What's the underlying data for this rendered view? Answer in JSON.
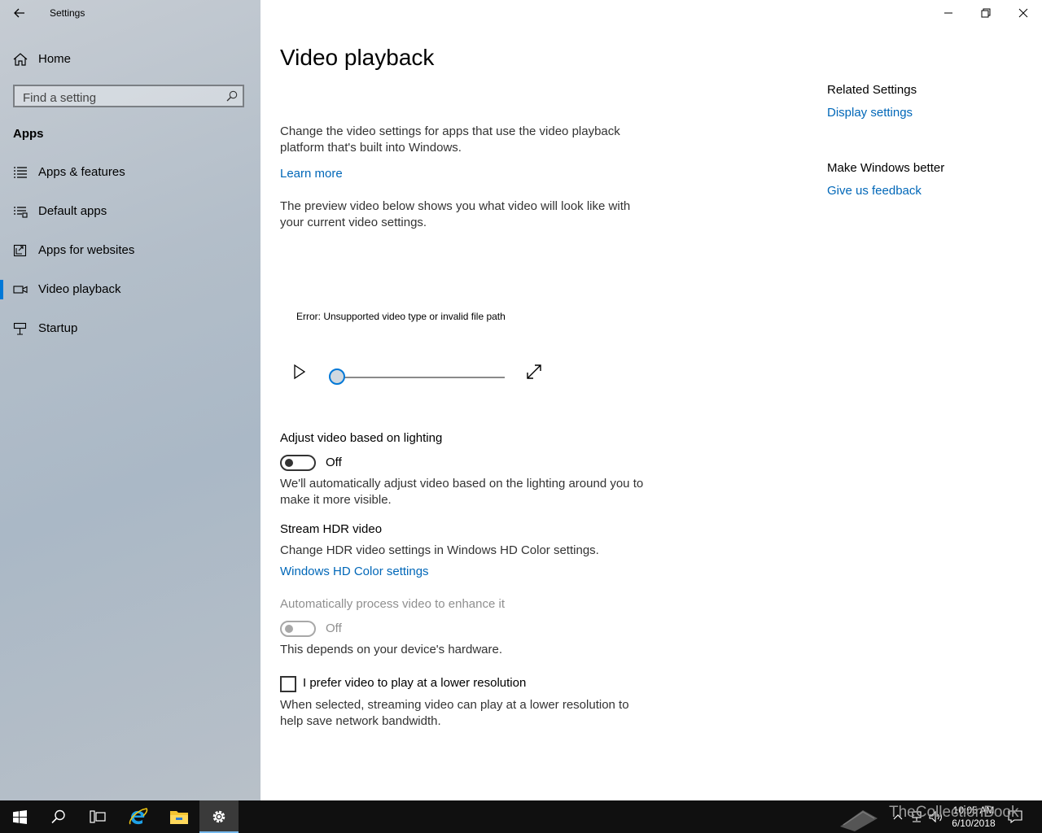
{
  "window": {
    "title": "Settings",
    "controls": [
      "minimize",
      "restore",
      "close"
    ]
  },
  "sidebar": {
    "home_label": "Home",
    "search_placeholder": "Find a setting",
    "section_title": "Apps",
    "items": [
      {
        "label": "Apps & features",
        "icon": "list-icon"
      },
      {
        "label": "Default apps",
        "icon": "default-apps-icon"
      },
      {
        "label": "Apps for websites",
        "icon": "apps-for-websites-icon"
      },
      {
        "label": "Video playback",
        "icon": "video-camera-icon",
        "selected": true
      },
      {
        "label": "Startup",
        "icon": "startup-icon"
      }
    ]
  },
  "main": {
    "title": "Video playback",
    "intro": "Change the video settings for apps that use the video playback platform that's built into Windows.",
    "learn_more": "Learn more",
    "preview_desc": "The preview video below shows you what video will look like with your current video settings.",
    "error_text": "Error: Unsupported video type or invalid file path",
    "player": {
      "progress": 0
    },
    "lighting": {
      "heading": "Adjust video based on lighting",
      "state": "Off",
      "desc": "We'll automatically adjust video based on the lighting around you to make it more visible."
    },
    "hdr": {
      "heading": "Stream HDR video",
      "desc": "Change HDR video settings in Windows HD Color settings.",
      "link": "Windows HD Color settings"
    },
    "enhance": {
      "heading": "Automatically process video to enhance it",
      "state": "Off",
      "desc": "This depends on your device's hardware."
    },
    "lower_res": {
      "label": "I prefer video to play at a lower resolution",
      "checked": false,
      "desc": "When selected, streaming video can play at a lower resolution to help save network bandwidth."
    }
  },
  "related": {
    "heading": "Related Settings",
    "display_link": "Display settings",
    "feedback_heading": "Make Windows better",
    "feedback_link": "Give us feedback"
  },
  "taskbar": {
    "time": "10:05 AM",
    "date": "6/10/2018",
    "watermark": "TheCollectionBook"
  },
  "colors": {
    "accent": "#0078d7",
    "link": "#0067b8",
    "taskbar": "#101010"
  }
}
